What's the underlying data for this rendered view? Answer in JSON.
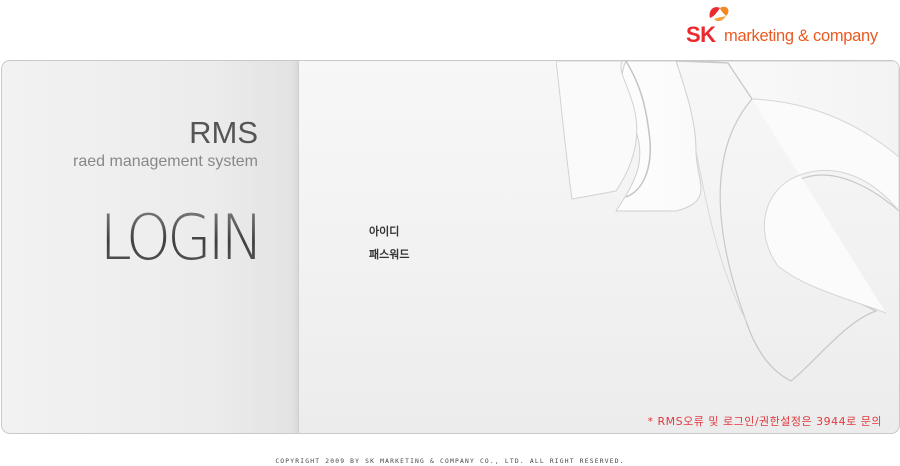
{
  "brand": {
    "sk": "SK",
    "company": "marketing & company",
    "icon": "sk-butterfly-icon",
    "colors": {
      "red": "#ea2a2f",
      "orange": "#f48a1f"
    }
  },
  "left": {
    "app_title": "RMS",
    "app_subtitle": "raed management system",
    "login_heading": "LOGIN"
  },
  "form": {
    "id_label": "아이디",
    "password_label": "패스워드"
  },
  "notice": "* RMS오류 및 로그인/권한설정은 3944로 문의",
  "footer": "COPYRIGHT 2009 BY SK MARKETING & COMPANY CO., LTD. ALL RIGHT RESERVED."
}
